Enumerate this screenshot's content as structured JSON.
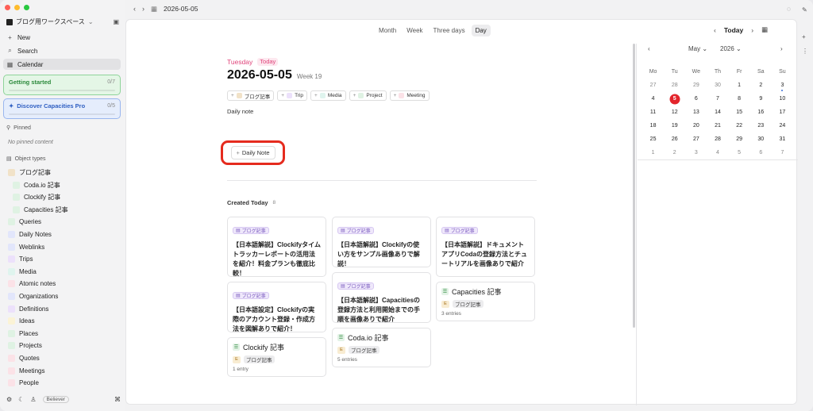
{
  "window": {
    "title_date": "2026-05-05"
  },
  "sidebar": {
    "workspace": "ブログ用ワークスペース",
    "new_label": "New",
    "search_label": "Search",
    "calendar_label": "Calendar",
    "getting_started": {
      "label": "Getting started",
      "count": "0/7"
    },
    "discover": {
      "label": "Discover Capacities Pro",
      "count": "0/5"
    },
    "pinned_label": "Pinned",
    "no_pinned": "No pinned content",
    "object_types_label": "Object types",
    "object_types": [
      {
        "label": "ブログ記事",
        "sub": false,
        "icon": "blog-icon",
        "color": "#f1e2c8"
      },
      {
        "label": "Coda.io 記事",
        "sub": true,
        "icon": "collection-icon",
        "color": "#dff2e3"
      },
      {
        "label": "Clockify 記事",
        "sub": true,
        "icon": "collection-icon",
        "color": "#dff2e3"
      },
      {
        "label": "Capacities 記事",
        "sub": true,
        "icon": "collection-icon",
        "color": "#dff2e3"
      },
      {
        "label": "Queries",
        "sub": false,
        "icon": "query-icon",
        "color": "#dff2e3"
      },
      {
        "label": "Daily Notes",
        "sub": false,
        "icon": "calendar-icon",
        "color": "#e2e6fb"
      },
      {
        "label": "Weblinks",
        "sub": false,
        "icon": "link-icon",
        "color": "#e2e6fb"
      },
      {
        "label": "Trips",
        "sub": false,
        "icon": "trip-icon",
        "color": "#ece1fb"
      },
      {
        "label": "Media",
        "sub": false,
        "icon": "media-icon",
        "color": "#dff4ee"
      },
      {
        "label": "Atomic notes",
        "sub": false,
        "icon": "atomic-icon",
        "color": "#fbe2e7"
      },
      {
        "label": "Organizations",
        "sub": false,
        "icon": "organization-icon",
        "color": "#e2e6fb"
      },
      {
        "label": "Definitions",
        "sub": false,
        "icon": "definition-icon",
        "color": "#ece1fb"
      },
      {
        "label": "Ideas",
        "sub": false,
        "icon": "idea-icon",
        "color": "#fbf3d6"
      },
      {
        "label": "Places",
        "sub": false,
        "icon": "place-icon",
        "color": "#dff2e3"
      },
      {
        "label": "Projects",
        "sub": false,
        "icon": "project-icon",
        "color": "#dff2e3"
      },
      {
        "label": "Quotes",
        "sub": false,
        "icon": "quote-icon",
        "color": "#fbe2e7"
      },
      {
        "label": "Meetings",
        "sub": false,
        "icon": "meeting-icon",
        "color": "#fbe2e7"
      },
      {
        "label": "People",
        "sub": false,
        "icon": "person-icon",
        "color": "#fbe2e7"
      }
    ],
    "footer_badge": "Believer"
  },
  "views": [
    "Month",
    "Week",
    "Three days",
    "Day"
  ],
  "active_view": "Day",
  "day": {
    "weekday": "Tuesday",
    "today_badge": "Today",
    "date": "2026-05-05",
    "week": "Week 19",
    "chips": [
      {
        "label": "ブログ記事",
        "color": "#f1e2c8"
      },
      {
        "label": "Trip",
        "color": "#ece1fb"
      },
      {
        "label": "Media",
        "color": "#dff4ee"
      },
      {
        "label": "Project",
        "color": "#dff2e3"
      },
      {
        "label": "Meeting",
        "color": "#fbe2e7"
      }
    ],
    "daily_note_label": "Daily note",
    "daily_note_button": "Daily Note",
    "created_today_label": "Created Today",
    "created_today_count": "8"
  },
  "cards": [
    {
      "type": "article",
      "tag": "ブログ記事",
      "title": "【日本語解説】Clockifyタイムトラッカーレポートの活用法を紹介！料金プランも徹底比較！"
    },
    {
      "type": "article",
      "tag": "ブログ記事",
      "title": "【日本語設定】Clockifyの実際のアカウント登録・作成方法を図解ありで紹介！"
    },
    {
      "type": "collection",
      "title": "Clockify 記事",
      "tag": "ブログ記事",
      "entries": "1 entry"
    },
    {
      "type": "article",
      "tag": "ブログ記事",
      "title": "【日本語解説】Clockifyの使い方をサンプル画像ありで解説！"
    },
    {
      "type": "article",
      "tag": "ブログ記事",
      "title": "【日本語解説】Capacitiesの登録方法と利用開始までの手順を画像ありで紹介"
    },
    {
      "type": "collection",
      "title": "Coda.io 記事",
      "tag": "ブログ記事",
      "entries": "5 entries"
    },
    {
      "type": "article",
      "tag": "ブログ記事",
      "title": "【日本語解説】ドキュメントアプリCodaの登録方法とチュートリアルを画像ありで紹介"
    },
    {
      "type": "collection",
      "title": "Capacities 記事",
      "tag": "ブログ記事",
      "entries": "3 entries"
    }
  ],
  "calendar": {
    "today_label": "Today",
    "month": "May",
    "year": "2026",
    "weekdays": [
      "Mo",
      "Tu",
      "We",
      "Th",
      "Fr",
      "Sa",
      "Su"
    ],
    "weeks": [
      [
        "27",
        "28",
        "29",
        "30",
        "1",
        "2",
        "3"
      ],
      [
        "4",
        "5",
        "6",
        "7",
        "8",
        "9",
        "10"
      ],
      [
        "11",
        "12",
        "13",
        "14",
        "15",
        "16",
        "17"
      ],
      [
        "18",
        "19",
        "20",
        "21",
        "22",
        "23",
        "24"
      ],
      [
        "25",
        "26",
        "27",
        "28",
        "29",
        "30",
        "31"
      ],
      [
        "1",
        "2",
        "3",
        "4",
        "5",
        "6",
        "7"
      ]
    ],
    "selected": "5"
  }
}
